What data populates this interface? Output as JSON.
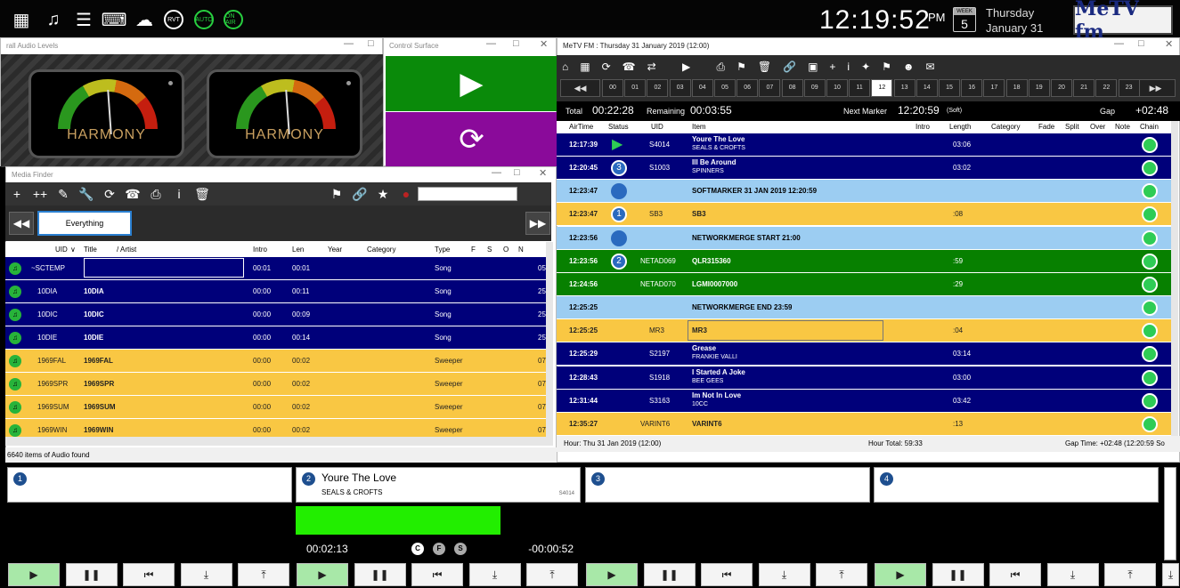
{
  "clock": {
    "time": "12:19:52",
    "ampm": "PM",
    "week_label": "WEEK",
    "day_num": "5",
    "day": "Thursday",
    "date": "January 31"
  },
  "brand": {
    "logo": "MeTV fm",
    "accent": "#1a2a80"
  },
  "top_icons": [
    "grid-icon",
    "music-note-icon",
    "list-icon",
    "keyboard-icon",
    "cloud-icon",
    "rvt-icon",
    "auto-icon",
    "on-air-icon"
  ],
  "top_icon_text": {
    "rvt": "RVT",
    "auto": "AUTO",
    "onair": "ON AIR"
  },
  "audio_levels": {
    "title": "rall Audio Levels",
    "meter_label": "HARMONY"
  },
  "control_surface": {
    "title": "Control Surface"
  },
  "media_finder": {
    "title": "Media Finder",
    "search_value": "",
    "filter": "Everything",
    "columns": [
      "UID",
      "Title",
      "/ Artist",
      "Intro",
      "Len",
      "Year",
      "Category",
      "Type",
      "F",
      "S",
      "O",
      "N"
    ],
    "rows": [
      {
        "uid": "~SCTEMP",
        "title": "",
        "intro": "00:01",
        "len": "00:01",
        "type": "Song",
        "extra": "05",
        "color": "blue"
      },
      {
        "uid": "10DIA",
        "title": "10DIA",
        "intro": "00:00",
        "len": "00:11",
        "type": "Song",
        "extra": "25",
        "color": "blue"
      },
      {
        "uid": "10DIC",
        "title": "10DIC",
        "intro": "00:00",
        "len": "00:09",
        "type": "Song",
        "extra": "25",
        "color": "blue"
      },
      {
        "uid": "10DIE",
        "title": "10DIE",
        "intro": "00:00",
        "len": "00:14",
        "type": "Song",
        "extra": "25",
        "color": "blue"
      },
      {
        "uid": "1969FAL",
        "title": "1969FAL",
        "intro": "00:00",
        "len": "00:02",
        "type": "Sweeper",
        "extra": "07",
        "color": "yellow"
      },
      {
        "uid": "1969SPR",
        "title": "1969SPR",
        "intro": "00:00",
        "len": "00:02",
        "type": "Sweeper",
        "extra": "07",
        "color": "yellow"
      },
      {
        "uid": "1969SUM",
        "title": "1969SUM",
        "intro": "00:00",
        "len": "00:02",
        "type": "Sweeper",
        "extra": "07",
        "color": "yellow"
      },
      {
        "uid": "1969WIN",
        "title": "1969WIN",
        "intro": "00:00",
        "len": "00:02",
        "type": "Sweeper",
        "extra": "07",
        "color": "yellow"
      }
    ],
    "status": "6640 items of Audio found"
  },
  "log": {
    "title": "MeTV FM : Thursday 31 January 2019 (12:00)",
    "hours": [
      "00",
      "01",
      "02",
      "03",
      "04",
      "05",
      "06",
      "07",
      "08",
      "09",
      "10",
      "11",
      "12",
      "13",
      "14",
      "15",
      "16",
      "17",
      "18",
      "19",
      "20",
      "21",
      "22",
      "23"
    ],
    "selected_hour": "12",
    "total_label": "Total",
    "total": "00:22:28",
    "remaining_label": "Remaining",
    "remaining": "00:03:55",
    "next_marker_label": "Next Marker",
    "next_marker": "12:20:59",
    "next_marker_note": "(Soft)",
    "gap_label": "Gap",
    "gap": "+02:48",
    "columns": [
      "AirTime",
      "Status",
      "UID",
      "Item",
      "Intro",
      "Length",
      "Category",
      "Fade",
      "Split",
      "Over",
      "Note",
      "Chain"
    ],
    "rows": [
      {
        "time": "12:17:39",
        "status": "play",
        "uid": "S4014",
        "item": "Youre The Love",
        "artist": "SEALS & CROFTS",
        "length": "03:06",
        "color": "blue"
      },
      {
        "time": "12:20:45",
        "status": "3",
        "uid": "S1003",
        "item": "Ill Be Around",
        "artist": "SPINNERS",
        "length": "03:02",
        "color": "blue"
      },
      {
        "time": "12:23:47",
        "status": "dot",
        "uid": "",
        "item": "SOFTMARKER 31 JAN 2019 12:20:59",
        "artist": "",
        "length": "",
        "color": "lblue"
      },
      {
        "time": "12:23:47",
        "status": "1",
        "uid": "SB3",
        "item": "SB3",
        "artist": "",
        "length": ":08",
        "color": "yellow"
      },
      {
        "time": "12:23:56",
        "status": "dot",
        "uid": "",
        "item": "NETWORKMERGE START 21:00",
        "artist": "",
        "length": "",
        "color": "lblue"
      },
      {
        "time": "12:23:56",
        "status": "2",
        "uid": "NETAD069",
        "item": "QLR315360",
        "artist": "",
        "length": ":59",
        "color": "green"
      },
      {
        "time": "12:24:56",
        "status": "",
        "uid": "NETAD070",
        "item": "LGMI0007000",
        "artist": "",
        "length": ":29",
        "color": "green"
      },
      {
        "time": "12:25:25",
        "status": "",
        "uid": "",
        "item": "NETWORKMERGE END 23:59",
        "artist": "",
        "length": "",
        "color": "lblue"
      },
      {
        "time": "12:25:25",
        "status": "",
        "uid": "MR3",
        "item": "MR3",
        "artist": "",
        "length": ":04",
        "color": "yellow"
      },
      {
        "time": "12:25:29",
        "status": "",
        "uid": "S2197",
        "item": "Grease",
        "artist": "FRANKIE VALLI",
        "length": "03:14",
        "color": "blue"
      },
      {
        "time": "12:28:43",
        "status": "",
        "uid": "S1918",
        "item": "I Started A Joke",
        "artist": "BEE GEES",
        "length": "03:00",
        "color": "blue"
      },
      {
        "time": "12:31:44",
        "status": "",
        "uid": "S3163",
        "item": "Im Not In Love",
        "artist": "10CC",
        "length": "03:42",
        "color": "blue"
      },
      {
        "time": "12:35:27",
        "status": "",
        "uid": "VARINT6",
        "item": "VARINT6",
        "artist": "",
        "length": ":13",
        "color": "yellow"
      }
    ],
    "footer_hour": "Hour: Thu 31 Jan 2019 (12:00)",
    "footer_total": "Hour Total: 59:33",
    "footer_gap": "Gap Time: +02:48 (12:20:59 So"
  },
  "players": [
    {
      "num": "1",
      "title": "",
      "artist": "",
      "uid": "",
      "elapsed": "",
      "remain": "",
      "progress": 0
    },
    {
      "num": "2",
      "title": "Youre The Love",
      "artist": "SEALS & CROFTS",
      "uid": "S4014",
      "elapsed": "00:02:13",
      "remain": "-00:00:52",
      "progress": 0.72
    },
    {
      "num": "3",
      "title": "",
      "artist": "",
      "uid": "",
      "elapsed": "",
      "remain": "",
      "progress": 0
    },
    {
      "num": "4",
      "title": "",
      "artist": "",
      "uid": "",
      "elapsed": "",
      "remain": "",
      "progress": 0
    }
  ],
  "player_flags": [
    "C",
    "F",
    "S"
  ],
  "player_buttons": [
    "play-icon",
    "pause-icon",
    "skip-back-icon",
    "load-down-icon",
    "eject-up-icon"
  ],
  "colors": {
    "blue": "#00007a",
    "yellow": "#f9c743",
    "green": "#078000",
    "lightblue": "#9ccdf2",
    "progress": "#22ee00"
  }
}
